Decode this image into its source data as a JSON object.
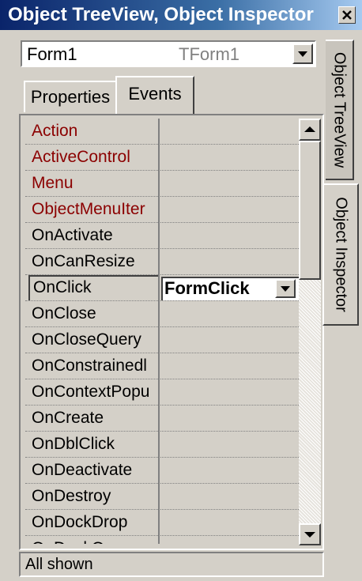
{
  "window": {
    "title": "Object TreeView, Object Inspector",
    "close_icon": "close-icon"
  },
  "component_selector": {
    "name": "Form1",
    "type": "TForm1",
    "icon": "chevron-down-icon"
  },
  "tabs": [
    {
      "label": "Properties",
      "active": false
    },
    {
      "label": "Events",
      "active": true
    }
  ],
  "events": [
    {
      "name": "Action",
      "value": "",
      "highlight": true
    },
    {
      "name": "ActiveControl",
      "value": "",
      "highlight": true
    },
    {
      "name": "Menu",
      "value": "",
      "highlight": true
    },
    {
      "name": "ObjectMenuIter",
      "value": "",
      "highlight": true
    },
    {
      "name": "OnActivate",
      "value": ""
    },
    {
      "name": "OnCanResize",
      "value": ""
    },
    {
      "name": "OnClick",
      "value": "FormClick",
      "selected": true
    },
    {
      "name": "OnClose",
      "value": ""
    },
    {
      "name": "OnCloseQuery",
      "value": ""
    },
    {
      "name": "OnConstrainedl",
      "value": ""
    },
    {
      "name": "OnContextPopu",
      "value": ""
    },
    {
      "name": "OnCreate",
      "value": ""
    },
    {
      "name": "OnDblClick",
      "value": ""
    },
    {
      "name": "OnDeactivate",
      "value": ""
    },
    {
      "name": "OnDestroy",
      "value": ""
    },
    {
      "name": "OnDockDrop",
      "value": ""
    },
    {
      "name": "OnDockOver",
      "value": ""
    }
  ],
  "status": "All shown",
  "side_tabs": [
    {
      "label": "Object TreeView",
      "active": false
    },
    {
      "label": "Object Inspector",
      "active": true
    }
  ],
  "colors": {
    "title_gradient_start": "#0a246a",
    "title_gradient_end": "#a6caf0",
    "highlight_text": "#8b0000",
    "window_bg": "#d4d0c8"
  }
}
